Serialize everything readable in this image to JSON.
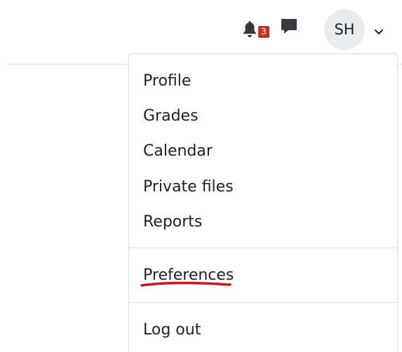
{
  "header": {
    "notifications": {
      "icon": "bell-icon",
      "count": "3",
      "badge_color": "#ca3120"
    },
    "messages": {
      "icon": "chat-icon"
    },
    "user": {
      "initials": "SH",
      "caret_icon": "chevron-down-icon"
    }
  },
  "user_menu": {
    "items": [
      {
        "label": "Profile"
      },
      {
        "label": "Grades"
      },
      {
        "label": "Calendar"
      },
      {
        "label": "Private files"
      },
      {
        "label": "Reports"
      }
    ],
    "preferences": {
      "label": "Preferences",
      "annotation_color": "#d0121b"
    },
    "logout": {
      "label": "Log out"
    }
  }
}
